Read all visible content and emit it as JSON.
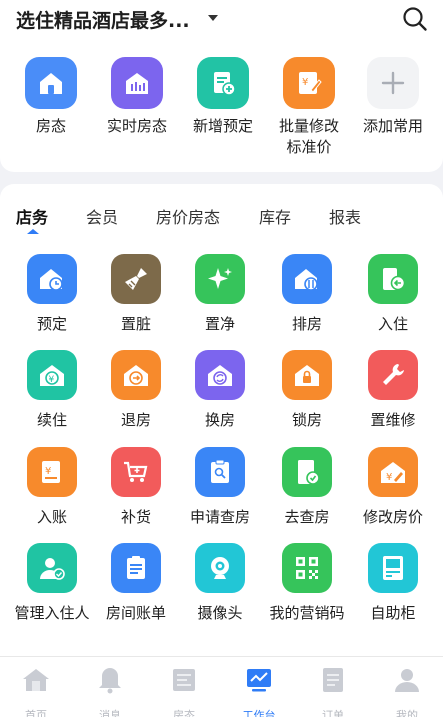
{
  "header": {
    "hotel_name": "选住精品酒店最多..."
  },
  "quick_actions": [
    {
      "label": "房态",
      "icon": "house-icon"
    },
    {
      "label": "实时房态",
      "icon": "bar-chart-icon"
    },
    {
      "label": "新增预定",
      "icon": "add-document-icon"
    },
    {
      "label": "批量修改\n标准价",
      "icon": "price-edit-icon"
    },
    {
      "label": "添加常用",
      "icon": "plus-icon"
    }
  ],
  "tabs": [
    {
      "label": "店务",
      "active": true
    },
    {
      "label": "会员",
      "active": false
    },
    {
      "label": "房价房态",
      "active": false
    },
    {
      "label": "库存",
      "active": false
    },
    {
      "label": "报表",
      "active": false
    }
  ],
  "grid": [
    {
      "label": "预定",
      "icon": "clock-house-icon"
    },
    {
      "label": "置脏",
      "icon": "broom-icon"
    },
    {
      "label": "置净",
      "icon": "sparkle-icon"
    },
    {
      "label": "排房",
      "icon": "swap-house-icon"
    },
    {
      "label": "入住",
      "icon": "check-in-icon"
    },
    {
      "label": "续住",
      "icon": "yen-house-icon"
    },
    {
      "label": "退房",
      "icon": "check-out-icon"
    },
    {
      "label": "换房",
      "icon": "refresh-house-icon"
    },
    {
      "label": "锁房",
      "icon": "lock-icon"
    },
    {
      "label": "置维修",
      "icon": "wrench-icon"
    },
    {
      "label": "入账",
      "icon": "yen-document-icon"
    },
    {
      "label": "补货",
      "icon": "cart-icon"
    },
    {
      "label": "申请查房",
      "icon": "clipboard-search-icon"
    },
    {
      "label": "去查房",
      "icon": "door-check-icon"
    },
    {
      "label": "修改房价",
      "icon": "edit-price-house-icon"
    },
    {
      "label": "管理入住人",
      "icon": "manage-guest-icon"
    },
    {
      "label": "房间账单",
      "icon": "bill-icon"
    },
    {
      "label": "摄像头",
      "icon": "camera-icon"
    },
    {
      "label": "我的营销码",
      "icon": "qr-code-icon"
    },
    {
      "label": "自助柜",
      "icon": "kiosk-icon"
    }
  ],
  "bottom_nav": [
    {
      "label": "首页",
      "icon": "home-icon",
      "active": false
    },
    {
      "label": "消息",
      "icon": "bell-icon",
      "active": false
    },
    {
      "label": "房态",
      "icon": "room-status-icon",
      "active": false
    },
    {
      "label": "工作台",
      "icon": "workbench-icon",
      "active": true
    },
    {
      "label": "订单",
      "icon": "order-icon",
      "active": false
    },
    {
      "label": "我的",
      "icon": "profile-icon",
      "active": false
    }
  ],
  "colors": {
    "blue": "#2f7cf6",
    "brown": "#7d6a4a",
    "green": "#36c45b",
    "teal": "#20c4a3",
    "orange": "#f78a2c",
    "purple": "#7c65ee",
    "red": "#f25b5b",
    "cyan": "#22c6d6"
  }
}
